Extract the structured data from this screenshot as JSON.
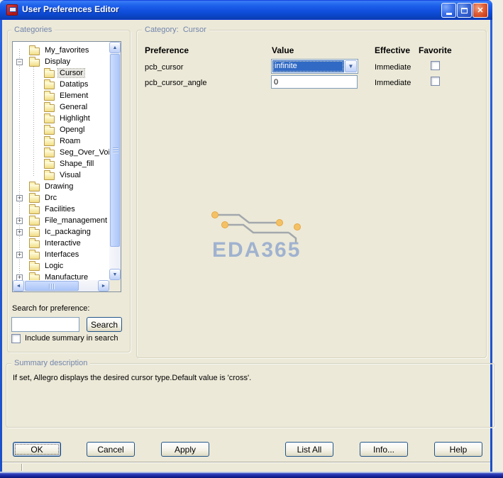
{
  "window": {
    "title": "User Preferences Editor"
  },
  "icons": {
    "close": "✕",
    "expander_open": "−",
    "expander_closed": "+",
    "combo_arrow": "▼",
    "scroll_up": "▲",
    "scroll_down": "▼",
    "scroll_left": "◄",
    "scroll_right": "►"
  },
  "categories_panel": {
    "group_label": "Categories",
    "tree_items": [
      {
        "label": "My_favorites",
        "level": 0,
        "expander": "none",
        "selected": false
      },
      {
        "label": "Display",
        "level": 0,
        "expander": "minus",
        "selected": false
      },
      {
        "label": "Cursor",
        "level": 1,
        "expander": "none",
        "selected": true
      },
      {
        "label": "Datatips",
        "level": 1,
        "expander": "none",
        "selected": false
      },
      {
        "label": "Element",
        "level": 1,
        "expander": "none",
        "selected": false
      },
      {
        "label": "General",
        "level": 1,
        "expander": "none",
        "selected": false
      },
      {
        "label": "Highlight",
        "level": 1,
        "expander": "none",
        "selected": false
      },
      {
        "label": "Opengl",
        "level": 1,
        "expander": "none",
        "selected": false
      },
      {
        "label": "Roam",
        "level": 1,
        "expander": "none",
        "selected": false
      },
      {
        "label": "Seg_Over_Voi",
        "level": 1,
        "expander": "none",
        "selected": false
      },
      {
        "label": "Shape_fill",
        "level": 1,
        "expander": "none",
        "selected": false
      },
      {
        "label": "Visual",
        "level": 1,
        "expander": "none",
        "selected": false
      },
      {
        "label": "Drawing",
        "level": 0,
        "expander": "none",
        "selected": false
      },
      {
        "label": "Drc",
        "level": 0,
        "expander": "plus",
        "selected": false
      },
      {
        "label": "Facilities",
        "level": 0,
        "expander": "none",
        "selected": false
      },
      {
        "label": "File_management",
        "level": 0,
        "expander": "plus",
        "selected": false
      },
      {
        "label": "Ic_packaging",
        "level": 0,
        "expander": "plus",
        "selected": false
      },
      {
        "label": "Interactive",
        "level": 0,
        "expander": "none",
        "selected": false
      },
      {
        "label": "Interfaces",
        "level": 0,
        "expander": "plus",
        "selected": false
      },
      {
        "label": "Logic",
        "level": 0,
        "expander": "none",
        "selected": false
      },
      {
        "label": "Manufacture",
        "level": 0,
        "expander": "plus",
        "selected": false
      }
    ],
    "search_label": "Search for preference:",
    "search_value": "",
    "search_button_label": "Search",
    "include_summary_label": "Include summary in search",
    "include_summary_checked": false
  },
  "preferences_panel": {
    "group_label": "Category:",
    "category_name": "Cursor",
    "columns": [
      "Preference",
      "Value",
      "Effective",
      "Favorite"
    ],
    "rows": [
      {
        "preference": "pcb_cursor",
        "value": "infinite",
        "control": "dropdown",
        "effective": "Immediate",
        "favorite_checked": false
      },
      {
        "preference": "pcb_cursor_angle",
        "value": "0",
        "control": "text",
        "effective": "Immediate",
        "favorite_checked": false
      }
    ],
    "watermark_text": "EDA365"
  },
  "summary_panel": {
    "group_label": "Summary description",
    "text": "If set, Allegro displays the desired cursor type.Default value is 'cross'."
  },
  "footer": {
    "buttons": [
      "OK",
      "Cancel",
      "Apply",
      "List All",
      "Info...",
      "Help"
    ]
  },
  "colors": {
    "titlebar_blue": "#1C5EEA",
    "selection_blue": "#316AC5",
    "dialog_face": "#ECE9D8",
    "groupbox_label": "#7285AC",
    "watermark_blue": "#98ADCF",
    "folder_yellow": "#F2DE86"
  }
}
